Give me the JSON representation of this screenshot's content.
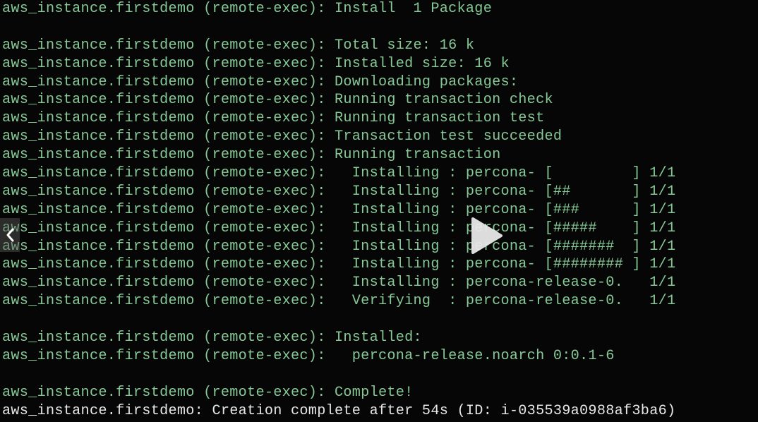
{
  "terminal": {
    "lines": [
      {
        "text": "aws_instance.firstdemo (remote-exec): Install  1 Package",
        "kind": "output"
      },
      {
        "text": "",
        "kind": "blank"
      },
      {
        "text": "aws_instance.firstdemo (remote-exec): Total size: 16 k",
        "kind": "output"
      },
      {
        "text": "aws_instance.firstdemo (remote-exec): Installed size: 16 k",
        "kind": "output"
      },
      {
        "text": "aws_instance.firstdemo (remote-exec): Downloading packages:",
        "kind": "output"
      },
      {
        "text": "aws_instance.firstdemo (remote-exec): Running transaction check",
        "kind": "output"
      },
      {
        "text": "aws_instance.firstdemo (remote-exec): Running transaction test",
        "kind": "output"
      },
      {
        "text": "aws_instance.firstdemo (remote-exec): Transaction test succeeded",
        "kind": "output"
      },
      {
        "text": "aws_instance.firstdemo (remote-exec): Running transaction",
        "kind": "output"
      },
      {
        "text": "aws_instance.firstdemo (remote-exec):   Installing : percona- [         ] 1/1",
        "kind": "output"
      },
      {
        "text": "aws_instance.firstdemo (remote-exec):   Installing : percona- [##       ] 1/1",
        "kind": "output"
      },
      {
        "text": "aws_instance.firstdemo (remote-exec):   Installing : percona- [###      ] 1/1",
        "kind": "output"
      },
      {
        "text": "aws_instance.firstdemo (remote-exec):   Installing : percona- [#####    ] 1/1",
        "kind": "output"
      },
      {
        "text": "aws_instance.firstdemo (remote-exec):   Installing : percona- [#######  ] 1/1",
        "kind": "output"
      },
      {
        "text": "aws_instance.firstdemo (remote-exec):   Installing : percona- [######## ] 1/1",
        "kind": "output"
      },
      {
        "text": "aws_instance.firstdemo (remote-exec):   Installing : percona-release-0.   1/1",
        "kind": "output"
      },
      {
        "text": "aws_instance.firstdemo (remote-exec):   Verifying  : percona-release-0.   1/1",
        "kind": "output"
      },
      {
        "text": "",
        "kind": "blank"
      },
      {
        "text": "aws_instance.firstdemo (remote-exec): Installed:",
        "kind": "output"
      },
      {
        "text": "aws_instance.firstdemo (remote-exec):   percona-release.noarch 0:0.1-6",
        "kind": "output"
      },
      {
        "text": "",
        "kind": "blank"
      },
      {
        "text": "aws_instance.firstdemo (remote-exec): Complete!",
        "kind": "output"
      },
      {
        "text": "aws_instance.firstdemo: Creation complete after 54s (ID: i-035539a0988af3ba6)",
        "kind": "final"
      }
    ]
  },
  "overlay": {
    "prev_icon": "chevron-left-icon",
    "play_icon": "play-icon"
  },
  "colors": {
    "background": "#060606",
    "output_text": "#86c996",
    "final_text": "#e6e6e6"
  }
}
